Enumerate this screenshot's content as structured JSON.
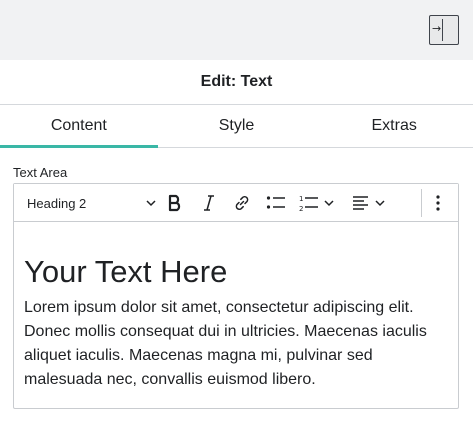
{
  "topbar": {
    "exit_icon": "exit-arrow-icon",
    "exit_glyph": "→"
  },
  "panel": {
    "title": "Edit: Text"
  },
  "tabs": [
    {
      "label": "Content",
      "active": true
    },
    {
      "label": "Style",
      "active": false
    },
    {
      "label": "Extras",
      "active": false
    }
  ],
  "field": {
    "label": "Text Area"
  },
  "toolbar": {
    "heading_value": "Heading 2",
    "buttons": [
      "bold-icon",
      "italic-icon",
      "link-icon",
      "bulleted-list-icon",
      "numbered-list-icon",
      "align-left-icon",
      "more-vertical-icon"
    ]
  },
  "editor": {
    "heading": "Your Text Here",
    "paragraph": "Lorem ipsum dolor sit amet, consectetur adipiscing elit. Donec mollis consequat dui in ultricies. Maecenas iaculis aliquet iaculis. Maecenas magna mi, pulvinar sed malesuada nec, convallis euismod libero."
  },
  "colors": {
    "accent": "#3ab7a6",
    "topbar_bg": "#f1f2f3",
    "text": "#1f2124",
    "border": "#d5d8dc"
  }
}
